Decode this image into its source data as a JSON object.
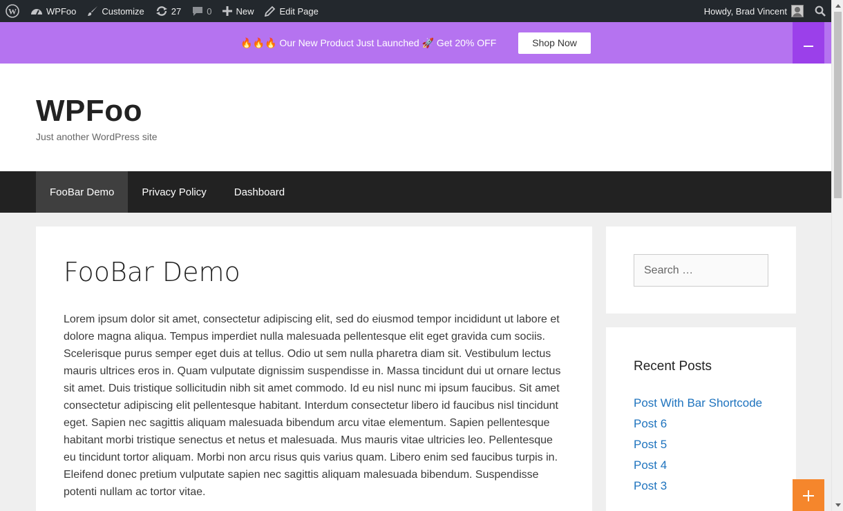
{
  "admin_bar": {
    "site_name": "WPFoo",
    "customize": "Customize",
    "updates_count": "27",
    "comments_count": "0",
    "new_label": "New",
    "edit_page": "Edit Page",
    "greeting": "Howdy, Brad Vincent"
  },
  "notification": {
    "text": "🔥🔥🔥 Our New Product Just Launched 🚀 Get 20% OFF",
    "button": "Shop Now",
    "bg_color": "#b573f0"
  },
  "header": {
    "title": "WPFoo",
    "tagline": "Just another WordPress site"
  },
  "nav": {
    "items": [
      {
        "label": "FooBar Demo"
      },
      {
        "label": "Privacy Policy"
      },
      {
        "label": "Dashboard"
      }
    ]
  },
  "page": {
    "title": "FooBar Demo",
    "body": "Lorem ipsum dolor sit amet, consectetur adipiscing elit, sed do eiusmod tempor incididunt ut labore et dolore magna aliqua. Tempus imperdiet nulla malesuada pellentesque elit eget gravida cum sociis. Scelerisque purus semper eget duis at tellus. Odio ut sem nulla pharetra diam sit. Vestibulum lectus mauris ultrices eros in. Quam vulputate dignissim suspendisse in. Massa tincidunt dui ut ornare lectus sit amet. Duis tristique sollicitudin nibh sit amet commodo. Id eu nisl nunc mi ipsum faucibus. Sit amet consectetur adipiscing elit pellentesque habitant. Interdum consectetur libero id faucibus nisl tincidunt eget. Sapien nec sagittis aliquam malesuada bibendum arcu vitae elementum. Sapien pellentesque habitant morbi tristique senectus et netus et malesuada. Mus mauris vitae ultricies leo. Pellentesque eu tincidunt tortor aliquam. Morbi non arcu risus quis varius quam. Libero enim sed faucibus turpis in. Eleifend donec pretium vulputate sapien nec sagittis aliquam malesuada bibendum. Suspendisse potenti nullam ac tortor vitae."
  },
  "sidebar": {
    "search_placeholder": "Search …",
    "recent_title": "Recent Posts",
    "recent_posts": [
      {
        "label": "Post With Bar Shortcode"
      },
      {
        "label": "Post 6"
      },
      {
        "label": "Post 5"
      },
      {
        "label": "Post 4"
      },
      {
        "label": "Post 3"
      }
    ]
  },
  "icons": {
    "wordpress": "wordpress-icon",
    "dashboard": "dashboard-icon",
    "customize": "brush-icon",
    "updates": "refresh-icon",
    "comments": "comment-icon",
    "new": "plus-icon",
    "edit": "pencil-icon",
    "search": "search-icon",
    "collapse": "minus-icon",
    "expand": "plus-icon"
  },
  "colors": {
    "accent_link": "#1e73be",
    "collapse_button": "#9b40ea",
    "expand_button": "#f5862c",
    "nav_bg": "#222222"
  }
}
